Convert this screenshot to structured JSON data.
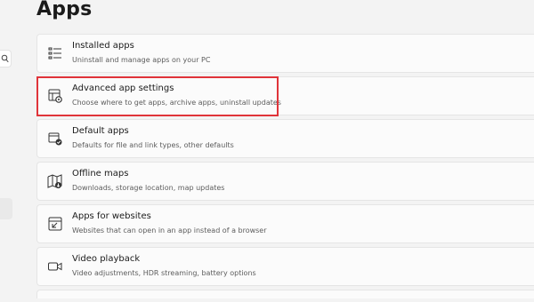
{
  "page_title": "Apps",
  "items": [
    {
      "title": "Installed apps",
      "description": "Uninstall and manage apps on your PC",
      "icon": "installed-apps-list-icon"
    },
    {
      "title": "Advanced app settings",
      "description": "Choose where to get apps, archive apps, uninstall updates",
      "icon": "app-settings-gear-icon"
    },
    {
      "title": "Default apps",
      "description": "Defaults for file and link types, other defaults",
      "icon": "default-apps-check-icon"
    },
    {
      "title": "Offline maps",
      "description": "Downloads, storage location, map updates",
      "icon": "offline-map-icon"
    },
    {
      "title": "Apps for websites",
      "description": "Websites that can open in an app instead of a browser",
      "icon": "apps-for-websites-icon"
    },
    {
      "title": "Video playback",
      "description": "Video adjustments, HDR streaming, battery options",
      "icon": "video-camera-icon"
    }
  ],
  "colors": {
    "background": "#f3f3f3",
    "card": "#fbfbfb",
    "card_border": "#e5e5e5",
    "highlight_border": "#e0343a",
    "description_text": "#5d5d5d"
  }
}
